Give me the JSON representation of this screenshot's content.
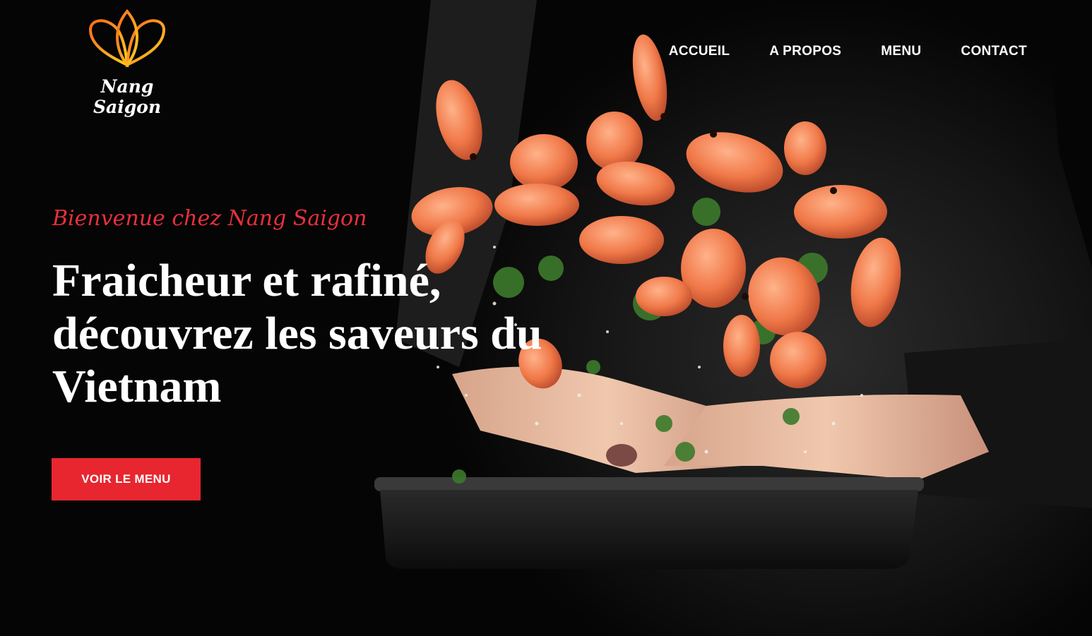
{
  "brand": {
    "name": "Nang Saigon",
    "logo_icon": "lotus-outline-icon"
  },
  "nav": {
    "items": [
      {
        "label": "ACCUEIL"
      },
      {
        "label": "A PROPOS"
      },
      {
        "label": "MENU"
      },
      {
        "label": "CONTACT"
      }
    ]
  },
  "hero": {
    "welcome": "Bienvenue chez Nang Saigon",
    "headline": "Fraicheur et rafiné, découvrez les saveurs du Vietnam",
    "cta_label": "VOIR LE MENU",
    "image": "chef-tossing-shrimp-in-pan"
  },
  "colors": {
    "background": "#050505",
    "accent": "#e8262f",
    "welcome_text": "#e8303d",
    "text": "#ffffff"
  }
}
